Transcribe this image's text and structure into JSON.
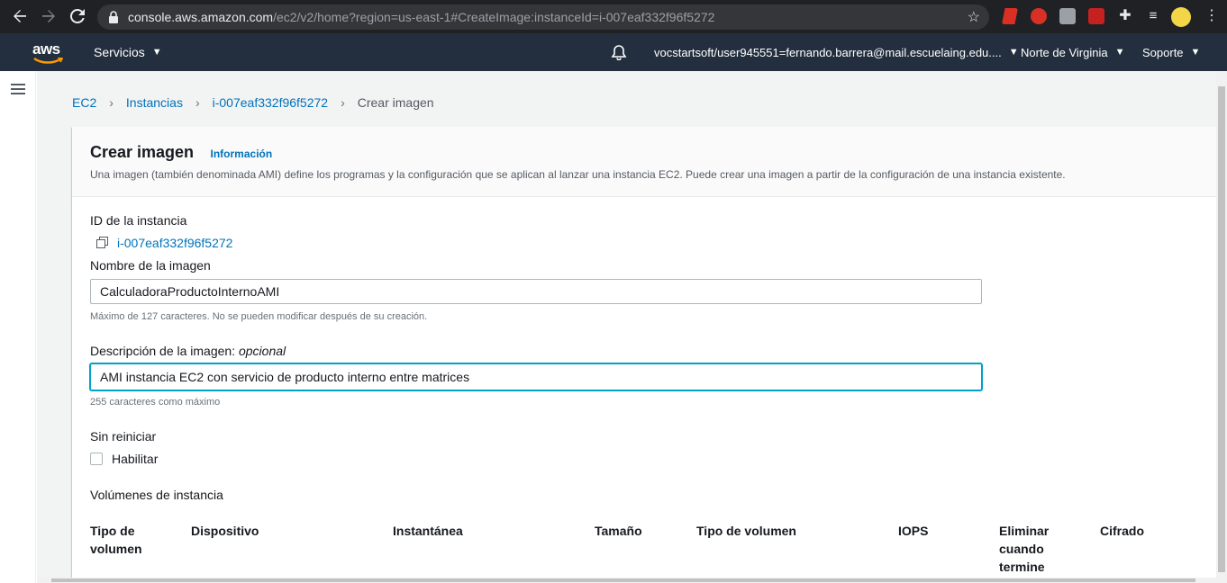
{
  "browser": {
    "url_host": "console.aws.amazon.com",
    "url_path": "/ec2/v2/home?region=us-east-1#CreateImage:instanceId=i-007eaf332f96f5272",
    "icons": [
      "back-icon",
      "forward-icon",
      "reload-icon",
      "lock-icon",
      "star-icon",
      "extensions-icon",
      "media-icon",
      "menu-icon"
    ]
  },
  "aws_nav": {
    "logo": "aws",
    "services_label": "Servicios",
    "account_label": "vocstartsoft/user945551=fernando.barrera@mail.escuelaing.edu....",
    "region_label": "Norte de Virginia",
    "support_label": "Soporte"
  },
  "breadcrumb": {
    "items": [
      "EC2",
      "Instancias",
      "i-007eaf332f96f5272"
    ],
    "current": "Crear imagen"
  },
  "header": {
    "title": "Crear imagen",
    "info_link": "Información",
    "description": "Una imagen (también denominada AMI) define los programas y la configuración que se aplican al lanzar una instancia EC2. Puede crear una imagen a partir de la configuración de una instancia existente."
  },
  "form": {
    "instance_id_label": "ID de la instancia",
    "instance_id_value": "i-007eaf332f96f5272",
    "image_name_label": "Nombre de la imagen",
    "image_name_value": "CalculadoraProductoInternoAMI",
    "image_name_hint": "Máximo de 127 caracteres. No se pueden modificar después de su creación.",
    "description_label": "Descripción de la imagen:",
    "description_optional": "opcional",
    "description_value": "AMI instancia EC2 con servicio de producto interno entre matrices",
    "description_hint": "255 caracteres como máximo",
    "no_reboot_label": "Sin reiniciar",
    "no_reboot_option": "Habilitar",
    "no_reboot_checked": false,
    "volumes_label": "Volúmenes de instancia"
  },
  "volumes_table": {
    "columns": [
      [
        "Tipo de",
        "volumen"
      ],
      [
        "Dispositivo"
      ],
      [
        "Instantánea"
      ],
      [
        "Tamaño"
      ],
      [
        "Tipo de volumen"
      ],
      [
        "IOPS"
      ],
      [
        "Eliminar",
        "cuando",
        "termine"
      ],
      [
        "Cifrado"
      ]
    ]
  },
  "colors": {
    "aws_nav_bg": "#232f3e",
    "link": "#0073bb",
    "focus": "#00a1c9",
    "browser_bg": "#202124"
  }
}
